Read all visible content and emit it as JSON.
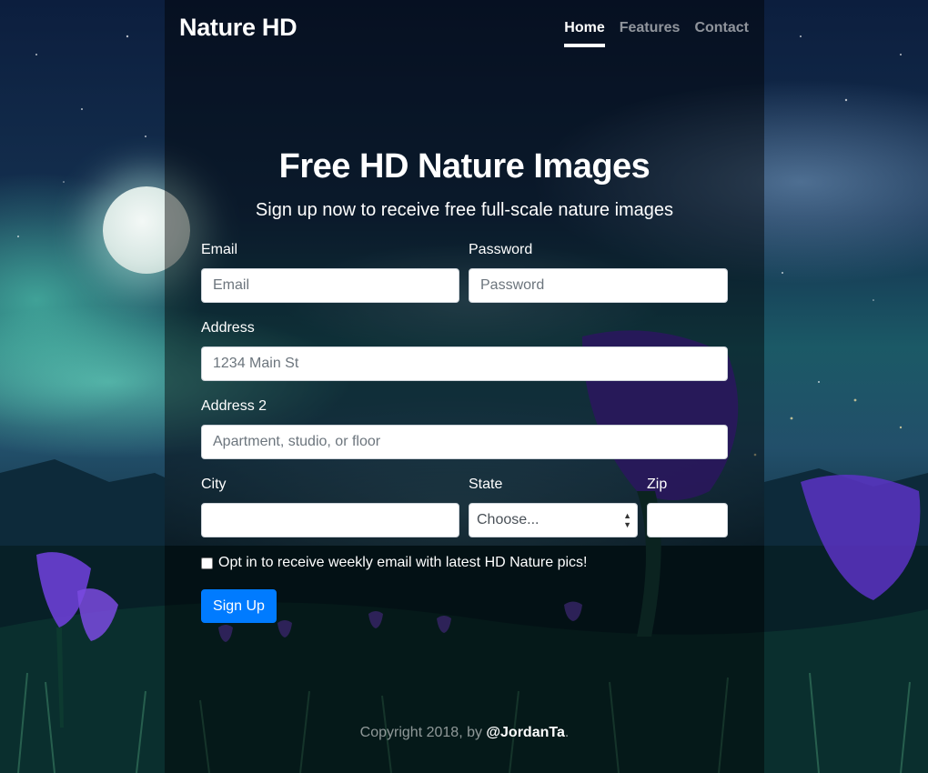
{
  "brand": "Nature HD",
  "nav": {
    "home": "Home",
    "features": "Features",
    "contact": "Contact"
  },
  "hero": {
    "title": "Free HD Nature Images",
    "subtitle": "Sign up now to receive free full-scale nature images"
  },
  "form": {
    "email": {
      "label": "Email",
      "placeholder": "Email"
    },
    "password": {
      "label": "Password",
      "placeholder": "Password"
    },
    "address": {
      "label": "Address",
      "placeholder": "1234 Main St"
    },
    "address2": {
      "label": "Address 2",
      "placeholder": "Apartment, studio, or floor"
    },
    "city": {
      "label": "City",
      "placeholder": ""
    },
    "state": {
      "label": "State",
      "selected": "Choose..."
    },
    "zip": {
      "label": "Zip",
      "placeholder": ""
    },
    "opt_in": "Opt in to receive weekly email with latest HD Nature pics!",
    "submit": "Sign Up"
  },
  "footer": {
    "prefix": "Copyright 2018, by ",
    "author": "@JordanTa",
    "suffix": "."
  },
  "colors": {
    "primary": "#007bff",
    "panel_overlay": "rgba(0,0,0,0.45)",
    "text": "#ffffff"
  }
}
